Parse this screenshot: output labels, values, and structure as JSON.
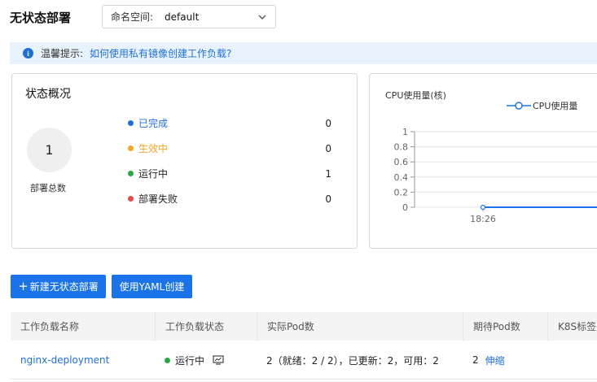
{
  "page": {
    "title": "无状态部署"
  },
  "namespace": {
    "label": "命名空间:",
    "value": "default"
  },
  "tip": {
    "label": "温馨提示:",
    "link": "如何使用私有镜像创建工作负载?"
  },
  "status_card": {
    "title": "状态概况",
    "total": "1",
    "total_label": "部署总数",
    "items": [
      {
        "name": "已完成",
        "count": "0",
        "color": "#1f6fd6",
        "text_color": "#1f6fd6"
      },
      {
        "name": "生效中",
        "count": "0",
        "color": "#f5a623",
        "text_color": "#f5a623"
      },
      {
        "name": "运行中",
        "count": "1",
        "color": "#27a844",
        "text_color": "#222222"
      },
      {
        "name": "部署失败",
        "count": "0",
        "color": "#e5484d",
        "text_color": "#222222"
      }
    ]
  },
  "cpu_card": {
    "title": "CPU使用量(核)",
    "legend": "CPU使用量"
  },
  "chart_data": {
    "type": "line",
    "title": "CPU使用量(核)",
    "series": [
      {
        "name": "CPU使用量",
        "values": [
          0,
          0
        ]
      }
    ],
    "x": [
      "18:26",
      ""
    ],
    "x_ticks": [
      "18:26"
    ],
    "y_ticks": [
      "0",
      "0.2",
      "0.4",
      "0.6",
      "0.8",
      "1"
    ],
    "ylim": [
      0,
      1
    ],
    "color": "#1a73e8",
    "legend_position": "top-right"
  },
  "buttons": {
    "new": "新建无状态部署",
    "yaml": "使用YAML创建"
  },
  "table": {
    "headers": [
      "工作负载名称",
      "工作负载状态",
      "实际Pod数",
      "期待Pod数",
      "K8S标签"
    ],
    "rows": [
      {
        "name": "nginx-deployment",
        "status": "运行中",
        "status_color": "#27a844",
        "actual_pods": "2（就绪：2 / 2），已更新：2，可用：2",
        "desired_pods": "2",
        "scale_link": "伸缩"
      }
    ]
  }
}
